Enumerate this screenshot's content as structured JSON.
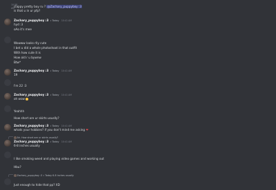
{
  "messages": [
    {
      "type": "continuation",
      "time": "10:58 AM",
      "text_parts": [
        "clappy pretty boy ru ? ",
        "@Zachary_puppyboy :3"
      ]
    },
    {
      "type": "continuation",
      "time": "",
      "text": "is that u in ur pfp?"
    },
    {
      "type": "header",
      "author": "Zachary_puppyboy :3",
      "badge": "⭑ Today",
      "stamp": "10:41 AM",
      "text": "hyd :3"
    },
    {
      "type": "continuation",
      "time": "",
      "text": "oAo it's mee"
    },
    {
      "type": "header",
      "author": "",
      "badge": "",
      "stamp": "",
      "text": "Wowww looks rlly cute"
    },
    {
      "type": "continuation",
      "time": "",
      "text": "I bet u did a whole photoshoot in that outfit"
    },
    {
      "type": "continuation",
      "time": "",
      "text": "With how cute it is"
    },
    {
      "type": "continuation",
      "time": "",
      "text": "How old r u bywnw"
    },
    {
      "type": "continuation",
      "time": "",
      "text": "Btw*"
    },
    {
      "type": "header",
      "author": "Zachary_puppyboy :3",
      "badge": "⭑ Today",
      "stamp": "10:41 AM",
      "text": "19"
    },
    {
      "type": "header",
      "author": "",
      "badge": "",
      "stamp": "",
      "text": "I'm 22 :3"
    },
    {
      "type": "header",
      "author": "Zachary_puppyboy :3",
      "badge": "⭑ Today",
      "stamp": "10:41 AM",
      "text": "oh wow",
      "emoji": "sad"
    },
    {
      "type": "header",
      "author": "",
      "badge": "",
      "stamp": "",
      "text": "Yeahhh"
    },
    {
      "type": "continuation",
      "time": "",
      "text": "How short are ur skirts ususlly?"
    },
    {
      "type": "header",
      "author": "Zachary_puppyboy :3",
      "badge": "⭑ Today",
      "stamp": "10:41 AM",
      "text": "whats your hobbies? if you don't mind me asking",
      "emoji": "heart"
    },
    {
      "type": "reply",
      "reply_text": "Ah. How short are ur skirts ususlly?"
    },
    {
      "type": "header",
      "author": "Zachary_puppyboy :3",
      "badge": "⭑ Today",
      "stamp": "10:41 AM",
      "text": "6-8 inches usually"
    },
    {
      "type": "header",
      "author": "",
      "badge": "",
      "stamp": "",
      "text": "I like smoking weed and playing video games and working out"
    },
    {
      "type": "continuation",
      "time": "",
      "text": "Hbu?"
    },
    {
      "type": "reply",
      "reply_text": "Zachary_puppyboy :3 ⭑ Today 6-8 inches usually"
    },
    {
      "type": "header",
      "author": "",
      "badge": "",
      "stamp": "",
      "text": "Just enough to hide that pp? XD"
    }
  ]
}
